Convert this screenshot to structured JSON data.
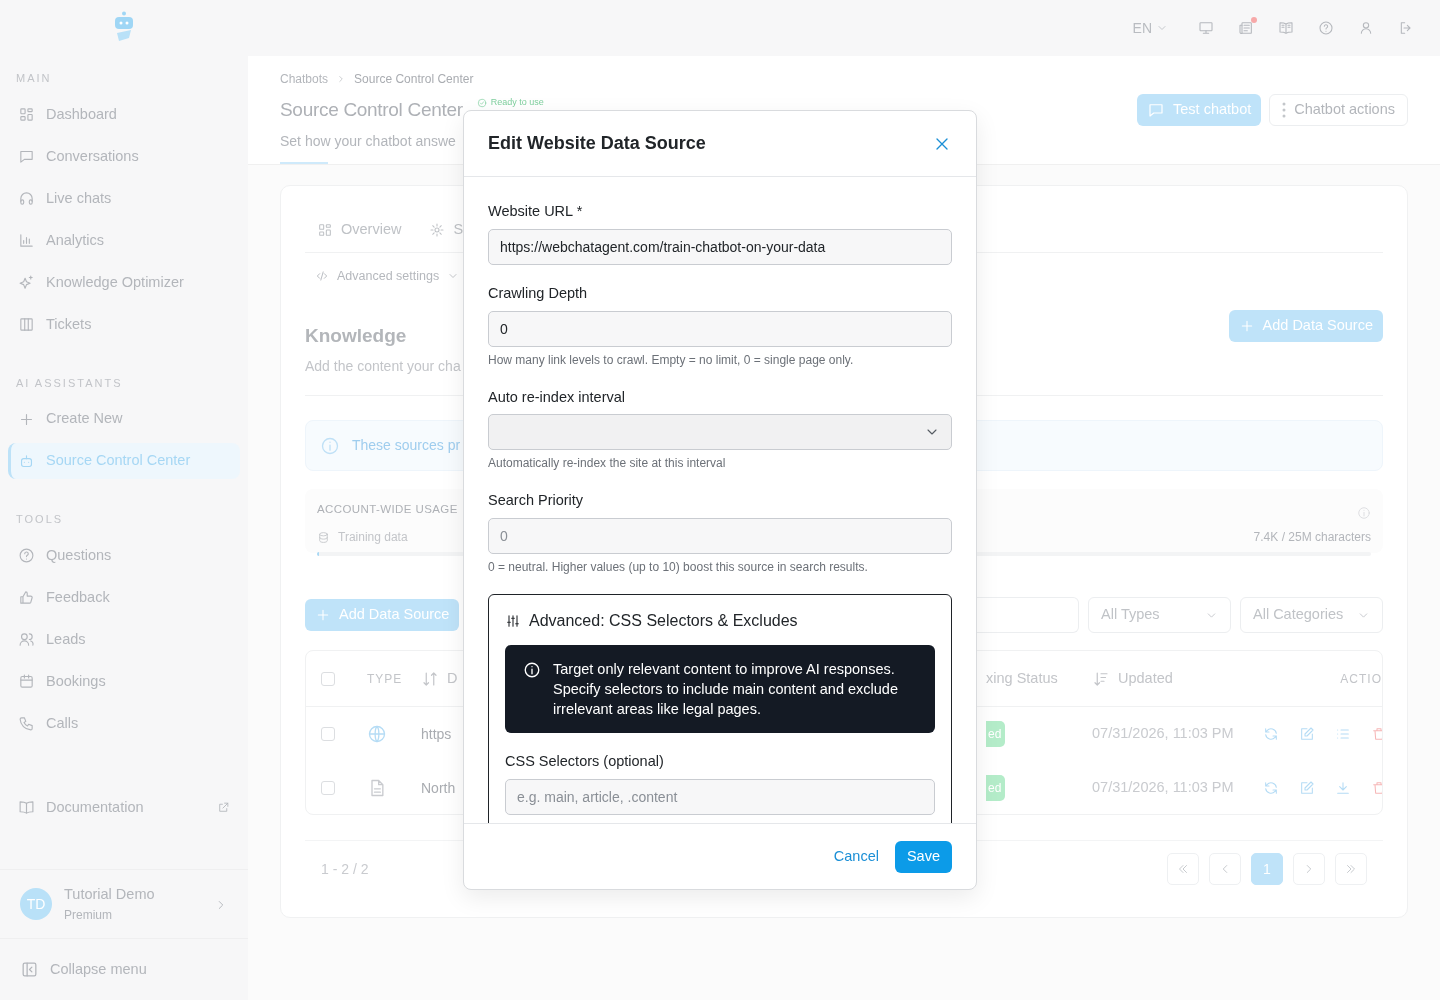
{
  "topbar": {
    "language": "EN",
    "notification_dot": true
  },
  "sidebar": {
    "sections": [
      {
        "title": "MAIN",
        "items": [
          {
            "label": "Dashboard",
            "selected": false
          },
          {
            "label": "Conversations",
            "selected": false
          },
          {
            "label": "Live chats",
            "selected": false
          },
          {
            "label": "Analytics",
            "selected": false
          },
          {
            "label": "Knowledge Optimizer",
            "selected": false
          },
          {
            "label": "Tickets",
            "selected": false
          }
        ]
      },
      {
        "title": "AI ASSISTANTS",
        "items": [
          {
            "label": "Create New",
            "selected": false
          },
          {
            "label": "Source Control Center",
            "selected": true
          }
        ]
      },
      {
        "title": "TOOLS",
        "items": [
          {
            "label": "Questions",
            "selected": false
          },
          {
            "label": "Feedback",
            "selected": false
          },
          {
            "label": "Leads",
            "selected": false
          },
          {
            "label": "Bookings",
            "selected": false
          },
          {
            "label": "Calls",
            "selected": false
          }
        ]
      }
    ],
    "documentation": "Documentation",
    "user": {
      "initials": "TD",
      "name": "Tutorial Demo",
      "plan": "Premium"
    },
    "collapse": "Collapse menu"
  },
  "header": {
    "breadcrumb": [
      "Chatbots",
      "Source Control Center"
    ],
    "title": "Source Control Center",
    "status_badge": "Ready to use",
    "subtitle": "Set how your chatbot answe",
    "buttons": [
      {
        "label": "Test chatbot",
        "kind": "primary"
      },
      {
        "label": "Chatbot actions",
        "kind": "outline"
      }
    ]
  },
  "tabs": [
    {
      "label": "Overview",
      "selected": false
    },
    {
      "label": "S",
      "selected": false
    }
  ],
  "advanced_settings": "Advanced settings",
  "knowledge": {
    "title": "Knowledge",
    "subtitle": "Add the content your cha",
    "add_button": "Add Data Source"
  },
  "info_alert": "These sources pr",
  "usage": {
    "title": "ACCOUNT-WIDE USAGE",
    "label": "Training data",
    "reading": "7.4K / 25M characters",
    "level": 0.002
  },
  "filters": {
    "add_button": "Add Data Source",
    "types": "All Types",
    "categories": "All Categories"
  },
  "table": {
    "select_all": {
      "checked": false
    },
    "columns": [
      "TYPE",
      "D",
      "xing Status",
      "Updated",
      "ACTIO"
    ],
    "rows": [
      {
        "selected": false,
        "kind": "website",
        "name": "https",
        "status": "ed",
        "updated": "07/31/2026, 11:03 PM"
      },
      {
        "selected": false,
        "kind": "file",
        "name": "North",
        "status": "ed",
        "updated": "07/31/2026, 11:03 PM"
      }
    ]
  },
  "pagination": {
    "summary": "1 - 2 / 2",
    "pages": [
      {
        "label": "1",
        "selected": true
      }
    ]
  },
  "modal": {
    "title": "Edit Website Data Source",
    "fields": [
      {
        "kind": "input",
        "label": "Website URL *",
        "value": "https://webchatagent.com/train-chatbot-on-your-data"
      },
      {
        "kind": "input",
        "label": "Crawling Depth",
        "value": "0",
        "help": "How many link levels to crawl. Empty = no limit, 0 = single page only."
      },
      {
        "kind": "select",
        "label": "Auto re-index interval",
        "help": "Automatically re-index the site at this interval"
      },
      {
        "kind": "input",
        "label": "Search Priority",
        "placeholder": "0",
        "help": "0 = neutral. Higher values (up to 10) boost this source in search results."
      }
    ],
    "advanced": {
      "title": "Advanced: CSS Selectors & Excludes",
      "notice": "Target only relevant content to improve AI responses. Specify selectors to include main content and exclude irrelevant areas like legal pages.",
      "field_label": "CSS Selectors (optional)",
      "field_placeholder": "e.g. main, article, .content"
    },
    "buttons": [
      {
        "label": "Cancel",
        "kind": "link"
      },
      {
        "label": "Save",
        "kind": "primary"
      }
    ]
  }
}
